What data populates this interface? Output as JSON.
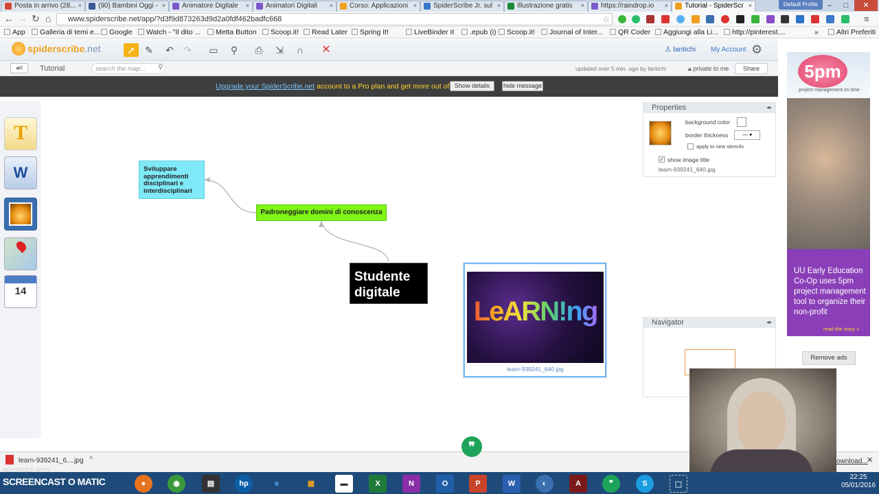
{
  "browser": {
    "tabs": [
      {
        "label": "Posta in arrivo (28...",
        "color": "#d14836"
      },
      {
        "label": "(90) Bambini Oggi -",
        "color": "#3b5998"
      },
      {
        "label": "Animatore Digitale",
        "color": "#7a5ac8"
      },
      {
        "label": "Animatori Digitali",
        "color": "#7a5ac8"
      },
      {
        "label": "Corso: Applicazioni",
        "color": "#f0a020"
      },
      {
        "label": "SpiderScribe Jr. sul",
        "color": "#3a78c8"
      },
      {
        "label": "Illustrazione gratis",
        "color": "#1a8a3a"
      },
      {
        "label": "https://raindrop.io",
        "color": "#7a5ac8"
      },
      {
        "label": "Tutorial - SpiderScr",
        "color": "#f0a020"
      }
    ],
    "profile": "Default Profile",
    "url": "www.spiderscribe.net/app/?d3f9d873263d9d2a0fdf462badfc668"
  },
  "bookmarks": [
    "App",
    "Galleria di temi e...",
    "Google",
    "Watch - \"Il dito ...",
    "Metta Button",
    "Scoop.it!",
    "Read Later",
    "Spring It!",
    "LiveBinder It",
    ".epub (i)",
    "Scoop.it!",
    "Journal of Inter...",
    "QR Coder",
    "Aggiungi alla Li...",
    "http://pinterest...."
  ],
  "bookmarks_other": "Altri Preferiti",
  "app": {
    "logo_main": "spiderscribe",
    "logo_suffix": ".net",
    "username": "lantichi",
    "my_account": "My Account",
    "map_title": "Tutorial",
    "search_placeholder": "search the map...",
    "updated": "updated over 5 min. ago by lantichi",
    "private": "private to me",
    "share": "Share"
  },
  "banner": {
    "link": "Upgrade your SpiderScribe.net",
    "text": "account to a Pro plan and get more out of it!",
    "show_details": "Show details",
    "hide_message": "hide message"
  },
  "nodes": {
    "svil": "Sviluppare apprendimenti disciplinari e interdisciplinari",
    "pad": "Padroneggiare domini di conoscenza",
    "stud": "Studente digitale",
    "image_label": "learn-939241_640.jpg",
    "image_word": "LeARN!ng"
  },
  "properties": {
    "title": "Properties",
    "bg_color": "background color",
    "border": "border thickness",
    "apply": "apply to new stencils",
    "show_title": "show image title",
    "filename": "learn-939241_640.jpg"
  },
  "navigator": {
    "title": "Navigator"
  },
  "ad": {
    "brand": "5pm",
    "tagline": "project management on time",
    "text": "UU Early Education Co-Op uses 5pm project management tool to organize their non-profit",
    "story": "read the story »",
    "remove": "Remove ads"
  },
  "calendar_day": "14",
  "download": {
    "file": "learn-939241_6....jpg",
    "all": "ownload..."
  },
  "taskbar": {
    "recorded": "RECORDED WITH",
    "brand": "SCREENCAST O MATIC",
    "time": "22:25",
    "date": "05/01/2016"
  }
}
